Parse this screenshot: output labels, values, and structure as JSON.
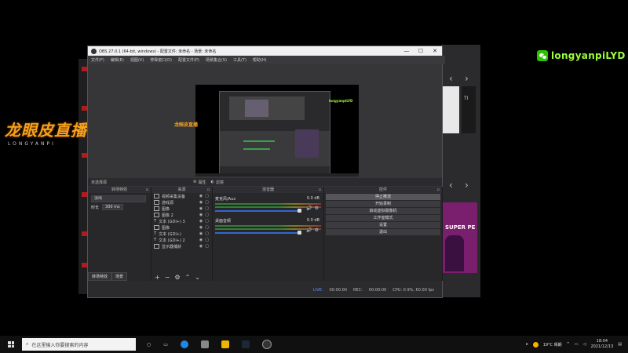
{
  "overlay": {
    "logo_cn": "龙眼皮直播",
    "logo_en": "LONGYANPI",
    "watermark": "longyanpiLYD"
  },
  "obs": {
    "title": "OBS 27.0.1 (64-bit, windows) - 配置文件: 未命名 - 场景: 未命名",
    "menu": [
      "文件(F)",
      "编辑(E)",
      "视图(V)",
      "停靠窗口(D)",
      "配置文件(P)",
      "场景集合(S)",
      "工具(T)",
      "帮助(H)"
    ],
    "preview_bar": {
      "source_label": "未选择源",
      "properties": "属性",
      "filters": "滤镜"
    },
    "docks": {
      "transitions": {
        "title": "转场特效",
        "selected": "淡出",
        "duration_label": "时长",
        "duration_value": "300 ms",
        "tab_transitions": "转场特效",
        "tab_scenes": "场景"
      },
      "sources": {
        "title": "来源",
        "items": [
          "视频采集设备",
          "游戏源",
          "图像",
          "图像 2",
          "文本 (GDI+) 3",
          "图像",
          "文本 (GDI+)",
          "文本 (GDI+) 2",
          "显示器捕获"
        ]
      },
      "mixer": {
        "title": "混音器",
        "tracks": [
          {
            "name": "麦克风/Aux",
            "db": "0.0 dB"
          },
          {
            "name": "桌面音频",
            "db": "0.0 dB"
          }
        ]
      },
      "controls": {
        "title": "控件",
        "buttons": [
          "停止推流",
          "开始录制",
          "启动虚拟摄像机",
          "工作室模式",
          "设置",
          "退出"
        ]
      }
    },
    "status": {
      "live_label": "LIVE:",
      "live_time": "00:00:00",
      "rec_label": "REC:",
      "rec_time": "00:00:00",
      "cpu": "CPU: 0.9%, 60.00 fps"
    },
    "window_controls": [
      "—",
      "☐",
      "✕"
    ]
  },
  "bg_window": {
    "thumb2_text": "TI",
    "promo_text": "SUPER PE",
    "nav_prev": "‹",
    "nav_next": "›"
  },
  "taskbar": {
    "search_placeholder": "在这里输入你要搜索的内容",
    "weather": "19°C 晴朗",
    "time": "18:04",
    "date": "2021/12/13"
  }
}
